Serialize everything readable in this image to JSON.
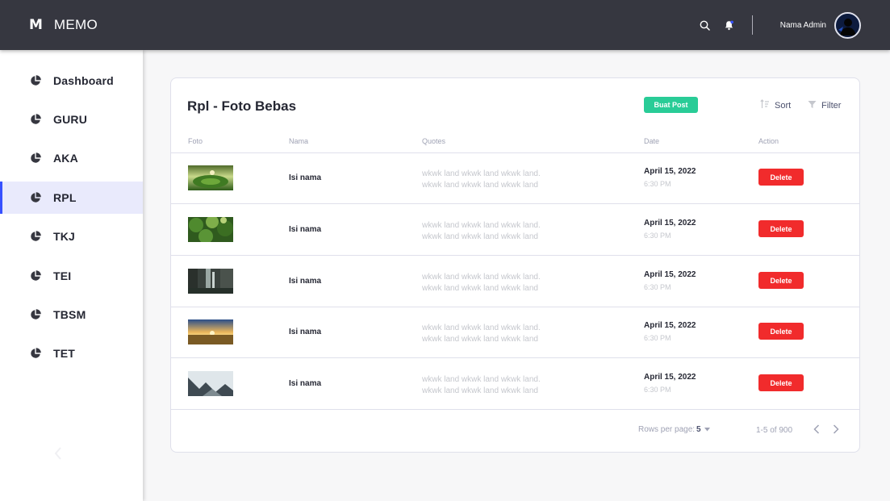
{
  "header": {
    "logo_letter": "M",
    "app_name": "MEMO",
    "admin_name": "Nama Admin",
    "icons": [
      "search-icon",
      "bell-icon"
    ]
  },
  "sidebar": {
    "items": [
      {
        "label": "Dashboard",
        "icon": "pie-chart-icon",
        "active": false
      },
      {
        "label": "GURU",
        "icon": "pie-chart-icon",
        "active": false
      },
      {
        "label": "AKA",
        "icon": "pie-chart-icon",
        "active": false
      },
      {
        "label": "RPL",
        "icon": "pie-chart-icon",
        "active": true
      },
      {
        "label": "TKJ",
        "icon": "pie-chart-icon",
        "active": false
      },
      {
        "label": "TEI",
        "icon": "pie-chart-icon",
        "active": false
      },
      {
        "label": "TBSM",
        "icon": "pie-chart-icon",
        "active": false
      },
      {
        "label": "TET",
        "icon": "pie-chart-icon",
        "active": false
      }
    ],
    "collapse_icon": "chevron-left-icon"
  },
  "card": {
    "title": "Rpl - Foto Bebas",
    "create_button": "Buat Post",
    "sort_label": "Sort",
    "filter_label": "Filter",
    "columns": [
      "Foto",
      "Nama",
      "Quotes",
      "Date",
      "Action"
    ],
    "rows": [
      {
        "photo": "landscape-green-field",
        "name": "Isi nama",
        "quote_1": "wkwk land wkwk land wkwk land.",
        "quote_2": "wkwk land wkwk land wkwk land",
        "date": "April 15, 2022",
        "time": "6:30 PM",
        "action": "Delete"
      },
      {
        "photo": "forest-foliage",
        "name": "Isi nama",
        "quote_1": "wkwk land wkwk land wkwk land.",
        "quote_2": "wkwk land wkwk land wkwk land",
        "date": "April 15, 2022",
        "time": "6:30 PM",
        "action": "Delete"
      },
      {
        "photo": "waterfall-rocks",
        "name": "Isi nama",
        "quote_1": "wkwk land wkwk land wkwk land.",
        "quote_2": "wkwk land wkwk land wkwk land",
        "date": "April 15, 2022",
        "time": "6:30 PM",
        "action": "Delete"
      },
      {
        "photo": "sunset-field",
        "name": "Isi nama",
        "quote_1": "wkwk land wkwk land wkwk land.",
        "quote_2": "wkwk land wkwk land wkwk land",
        "date": "April 15, 2022",
        "time": "6:30 PM",
        "action": "Delete"
      },
      {
        "photo": "mountain-valley",
        "name": "Isi nama",
        "quote_1": "wkwk land wkwk land wkwk land.",
        "quote_2": "wkwk land wkwk land wkwk land",
        "date": "April 15, 2022",
        "time": "6:30 PM",
        "action": "Delete"
      }
    ],
    "pagination": {
      "rows_per_page_label": "Rows per page:",
      "rows_per_page_value": "5",
      "range": "1-5 of 900"
    }
  },
  "colors": {
    "topbar": "#363740",
    "active_nav": "#e9eafc",
    "accent": "#3751ff",
    "create_button": "#29cc97",
    "delete_button": "#f12b2c"
  }
}
